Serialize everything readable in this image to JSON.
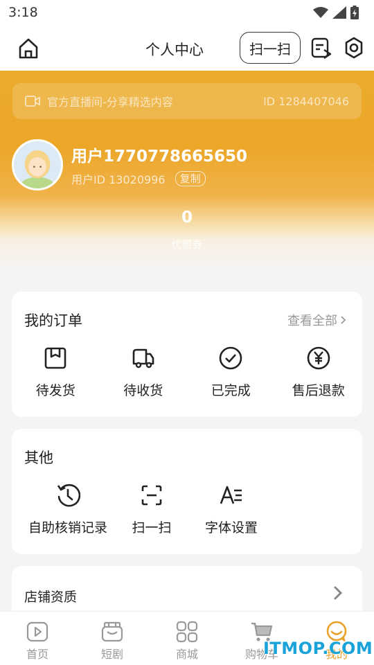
{
  "status_bar": {
    "time": "3:18"
  },
  "topbar": {
    "title": "个人中心",
    "scan_label": "扫一扫"
  },
  "profile": {
    "live_text": "官方直播间-分享精选内容",
    "live_id": "ID 1284407046",
    "username": "用户1770778665650",
    "user_id": "用户ID 13020996",
    "copy_label": "复制",
    "coupon_count": "0",
    "coupon_label": "优惠券"
  },
  "orders": {
    "title": "我的订单",
    "view_all": "查看全部",
    "items": [
      {
        "label": "待发货",
        "icon": "box-icon"
      },
      {
        "label": "待收货",
        "icon": "truck-icon"
      },
      {
        "label": "已完成",
        "icon": "check-circle-icon"
      },
      {
        "label": "售后退款",
        "icon": "yuan-circle-icon"
      }
    ]
  },
  "other": {
    "title": "其他",
    "items": [
      {
        "label": "自助核销记录",
        "icon": "history-icon"
      },
      {
        "label": "扫一扫",
        "icon": "scan-icon"
      },
      {
        "label": "字体设置",
        "icon": "font-icon"
      }
    ]
  },
  "shop": {
    "label": "店铺资质"
  },
  "tabs": [
    {
      "label": "首页",
      "icon": "play-icon"
    },
    {
      "label": "短剧",
      "icon": "drama-icon"
    },
    {
      "label": "商城",
      "icon": "grid-icon"
    },
    {
      "label": "购物车",
      "icon": "cart-icon"
    },
    {
      "label": "我的",
      "icon": "smile-icon"
    }
  ],
  "watermark": "ITMOP.COM",
  "colors": {
    "accent": "#e9a228",
    "text": "#222222",
    "muted": "#999999"
  }
}
